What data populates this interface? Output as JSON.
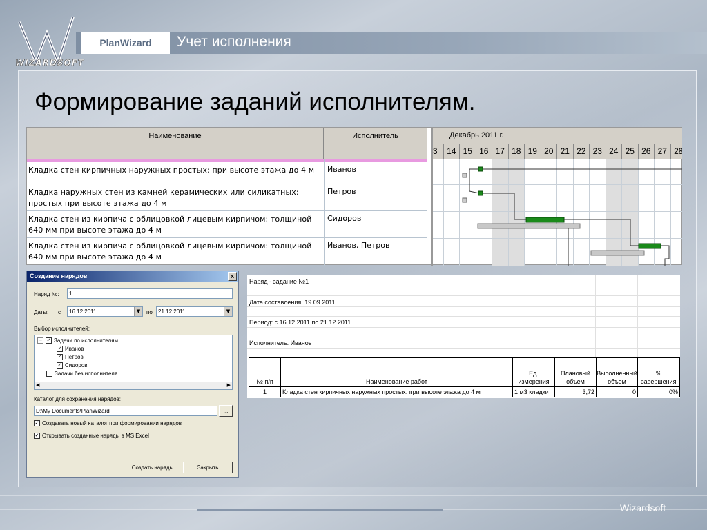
{
  "header": {
    "brand": "PlanWizard",
    "section": "Учет исполнения",
    "logo_text": "WIZARDSOFT"
  },
  "title": "Формирование заданий исполнителям.",
  "gantt": {
    "col_name": "Наименование",
    "col_executor": "Исполнитель",
    "month": "Декабрь 2011 г.",
    "days": [
      "3",
      "14",
      "15",
      "16",
      "17",
      "18",
      "19",
      "20",
      "21",
      "22",
      "23",
      "24",
      "25",
      "26",
      "27",
      "28"
    ],
    "tasks": [
      {
        "name": "Кладка стен кирпичных наружных простых: при высоте этажа до 4 м",
        "executor": "Иванов"
      },
      {
        "name": "Кладка наружных стен из камней керамических или силикатных: простых при высоте этажа до 4 м",
        "executor": "Петров"
      },
      {
        "name": "Кладка стен из кирпича с облицовкой лицевым кирпичом: толщиной 640 мм при высоте этажа до 4 м",
        "executor": "Сидоров"
      },
      {
        "name": "Кладка стен из кирпича с облицовкой лицевым кирпичом: толщиной 640 мм при высоте этажа до 4 м",
        "executor": "Иванов, Петров"
      }
    ]
  },
  "dialog": {
    "title": "Создание нарядов",
    "close": "x",
    "order_no_label": "Наряд №:",
    "order_no_value": "1",
    "dates_label": "Даты:",
    "from_label": "с",
    "from_value": "16.12.2011",
    "to_label": "по",
    "to_value": "21.12.2011",
    "executors_label": "Выбор исполнителей:",
    "tree": {
      "group1": "Задачи по исполнителям",
      "items": [
        "Иванов",
        "Петров",
        "Сидоров"
      ],
      "group2": "Задачи без исполнителя"
    },
    "folder_label": "Каталог для сохранения нарядов:",
    "folder_value": "D:\\My Documents\\PlanWizard",
    "browse": "...",
    "opt_new_folder": "Создавать новый каталог при формировании нарядов",
    "opt_open_excel": "Открывать созданные наряды в MS Excel",
    "create_button": "Создать наряды",
    "close_button": "Закрыть"
  },
  "excel": {
    "line1": "Наряд - задание №1",
    "line2": "Дата составления: 19.09.2011",
    "line3": "Период: с 16.12.2011 по 21.12.2011",
    "line4": "Исполнитель: Иванов",
    "headers": [
      "№ п/п",
      "Наименование работ",
      "Ед. измерения",
      "Плановый объем",
      "Выполненный объем",
      "% завершения"
    ],
    "row": {
      "no": "1",
      "name": "Кладка стен кирпичных наружных простых: при высоте этажа до 4 м",
      "unit": "1 м3 кладки",
      "plan": "3,72",
      "done": "0",
      "pct": "0%"
    }
  },
  "footer": "Wizardsoft"
}
